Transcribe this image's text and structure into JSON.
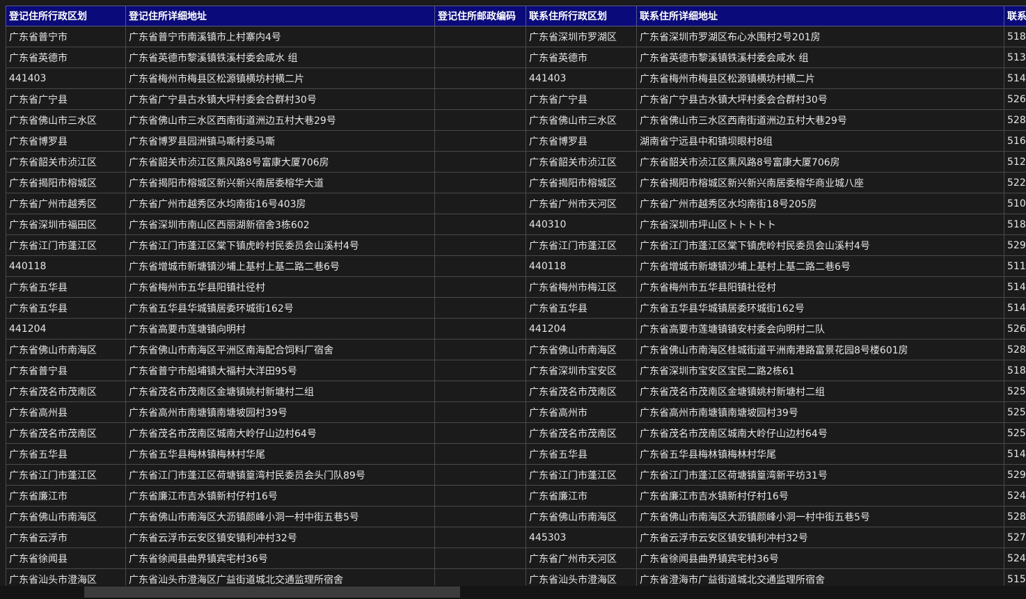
{
  "columns": [
    "登记住所行政区划",
    "登记住所详细地址",
    "登记住所邮政编码",
    "联系住所行政区划",
    "联系住所详细地址",
    "联系"
  ],
  "rows": [
    [
      "广东省普宁市",
      "广东省普宁市南溪镇市上村寨内4号",
      "",
      "广东省深圳市罗湖区",
      "广东省深圳市罗湖区布心水围村2号201房",
      "518"
    ],
    [
      "广东省英德市",
      "广东省英德市黎溪镇铁溪村委会咸水 组",
      "",
      "广东省英德市",
      "广东省英德市黎溪镇铁溪村委会咸水 组",
      "513"
    ],
    [
      "441403",
      "广东省梅州市梅县区松源镇横坊村横二片",
      "",
      "441403",
      "广东省梅州市梅县区松源镇横坊村横二片",
      "514"
    ],
    [
      "广东省广宁县",
      "广东省广宁县古水镇大坪村委会合群村30号",
      "",
      "广东省广宁县",
      "广东省广宁县古水镇大坪村委会合群村30号",
      "526"
    ],
    [
      "广东省佛山市三水区",
      "广东省佛山市三水区西南街道洲边五村大巷29号",
      "",
      "广东省佛山市三水区",
      "广东省佛山市三水区西南街道洲边五村大巷29号",
      "528"
    ],
    [
      "广东省博罗县",
      "广东省博罗县园洲镇马嘶村委马嘶",
      "",
      "广东省博罗县",
      "湖南省宁远县中和镇坝眼村8组",
      "516"
    ],
    [
      "广东省韶关市浈江区",
      "广东省韶关市浈江区熏风路8号富康大厦706房",
      "",
      "广东省韶关市浈江区",
      "广东省韶关市浈江区熏风路8号富康大厦706房",
      "512"
    ],
    [
      "广东省揭阳市榕城区",
      "广东省揭阳市榕城区新兴新兴南居委榕华大道",
      "",
      "广东省揭阳市榕城区",
      "广东省揭阳市榕城区新兴新兴南居委榕华商业城八座",
      "522"
    ],
    [
      "广东省广州市越秀区",
      "广东省广州市越秀区水均南街16号403房",
      "",
      "广东省广州市天河区",
      "广东省广州市越秀区水均南街18号205房",
      "510"
    ],
    [
      "广东省深圳市福田区",
      "广东省深圳市南山区西丽湖新宿舍3栋602",
      "",
      "440310",
      "广东省深圳市坪山区トトトトト",
      "518"
    ],
    [
      "广东省江门市蓬江区",
      "广东省江门市蓬江区棠下镇虎岭村民委员会山溪村4号",
      "",
      "广东省江门市蓬江区",
      "广东省江门市蓬江区棠下镇虎岭村民委员会山溪村4号",
      "529"
    ],
    [
      "440118",
      "广东省增城市新塘镇沙埔上基村上基二路二巷6号",
      "",
      "440118",
      "广东省增城市新塘镇沙埔上基村上基二路二巷6号",
      "511"
    ],
    [
      "广东省五华县",
      "广东省梅州市五华县阳镇社径村",
      "",
      "广东省梅州市梅江区",
      "广东省梅州市五华县阳镇社径村",
      "514"
    ],
    [
      "广东省五华县",
      "广东省五华县华城镇居委环城街162号",
      "",
      "广东省五华县",
      "广东省五华县华城镇居委环城街162号",
      "514"
    ],
    [
      "441204",
      "广东省高要市莲塘镇向明村",
      "",
      "441204",
      "广东省高要市莲塘镇镇安村委会向明村二队",
      "526"
    ],
    [
      "广东省佛山市南海区",
      "广东省佛山市南海区平洲区南海配合饲料厂宿舍",
      "",
      "广东省佛山市南海区",
      "广东省佛山市南海区桂城街道平洲南港路富景花园8号楼601房",
      "528"
    ],
    [
      "广东省普宁县",
      "广东省普宁市船埔镇大福村大洋田95号",
      "",
      "广东省深圳市宝安区",
      "广东省深圳市宝安区宝民二路2栋61",
      "518"
    ],
    [
      "广东省茂名市茂南区",
      "广东省茂名市茂南区金塘镇姚村新塘村二组",
      "",
      "广东省茂名市茂南区",
      "广东省茂名市茂南区金塘镇姚村新塘村二组",
      "525"
    ],
    [
      "广东省高州县",
      "广东省高州市南塘镇南塘坡园村39号",
      "",
      "广东省高州市",
      "广东省高州市南塘镇南塘坡园村39号",
      "525"
    ],
    [
      "广东省茂名市茂南区",
      "广东省茂名市茂南区城南大岭仔山边村64号",
      "",
      "广东省茂名市茂南区",
      "广东省茂名市茂南区城南大岭仔山边村64号",
      "525"
    ],
    [
      "广东省五华县",
      "广东省五华县梅林镇梅林村华尾",
      "",
      "广东省五华县",
      "广东省五华县梅林镇梅林村华尾",
      "514"
    ],
    [
      "广东省江门市蓬江区",
      "广东省江门市蓬江区荷塘镇篁湾村民委员会头门队89号",
      "",
      "广东省江门市蓬江区",
      "广东省江门市蓬江区荷塘镇篁湾新平坊31号",
      "529"
    ],
    [
      "广东省廉江市",
      "广东省廉江市吉水镇新村仔村16号",
      "",
      "广东省廉江市",
      "广东省廉江市吉水镇新村仔村16号",
      "524"
    ],
    [
      "广东省佛山市南海区",
      "广东省佛山市南海区大沥镇颜峰小洞一村中街五巷5号",
      "",
      "广东省佛山市南海区",
      "广东省佛山市南海区大沥镇颜峰小洞一村中街五巷5号",
      "528"
    ],
    [
      "广东省云浮市",
      "广东省云浮市云安区镇安镇利冲村32号",
      "",
      "445303",
      "广东省云浮市云安区镇安镇利冲村32号",
      "527"
    ],
    [
      "广东省徐闻县",
      "广东省徐闻县曲界镇宾宅村36号",
      "",
      "广东省广州市天河区",
      "广东省徐闻县曲界镇宾宅村36号",
      "524"
    ],
    [
      "广东省汕头市澄海区",
      "广东省汕头市澄海区广益街道城北交通监理所宿舍",
      "",
      "广东省汕头市澄海区",
      "广东省澄海市广益街道城北交通监理所宿舍",
      "515"
    ]
  ]
}
